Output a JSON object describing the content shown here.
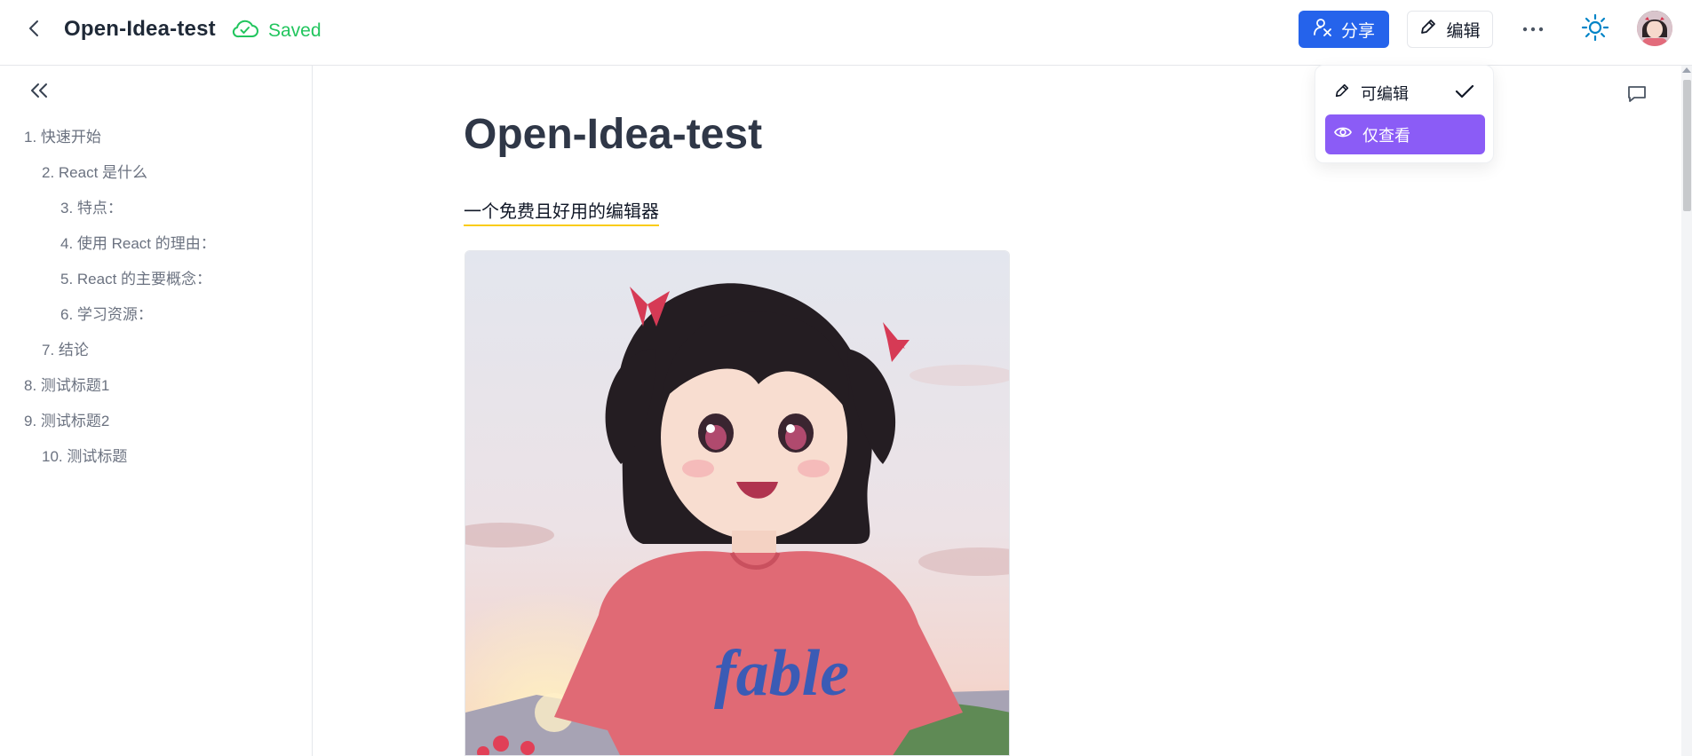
{
  "header": {
    "back_icon": "chevron-left-icon",
    "title": "Open-Idea-test",
    "saved_label": "Saved",
    "share_label": "分享",
    "edit_label": "编辑",
    "colors": {
      "primary": "#2563eb",
      "saved": "#22c55e",
      "theme_icon": "#0284c7"
    }
  },
  "dropdown": {
    "items": [
      {
        "label": "可编辑",
        "icon": "pencil-icon",
        "checked": true
      },
      {
        "label": "仅查看",
        "icon": "eye-icon",
        "selected": true
      }
    ],
    "highlight_color": "#8b5cf6"
  },
  "sidebar": {
    "toc": [
      {
        "label": "1. 快速开始"
      },
      {
        "label": "2. React 是什么"
      },
      {
        "label": "3. 特点："
      },
      {
        "label": "4. 使用 React 的理由："
      },
      {
        "label": "5. React 的主要概念："
      },
      {
        "label": "6. 学习资源："
      },
      {
        "label": "7. 结论"
      },
      {
        "label": "8. 测试标题1"
      },
      {
        "label": "9. 测试标题2"
      },
      {
        "label": "10. 测试标题"
      }
    ]
  },
  "main": {
    "title": "Open-Idea-test",
    "subtitle": "一个免费且好用的编辑器",
    "shirt_text": "fable"
  }
}
